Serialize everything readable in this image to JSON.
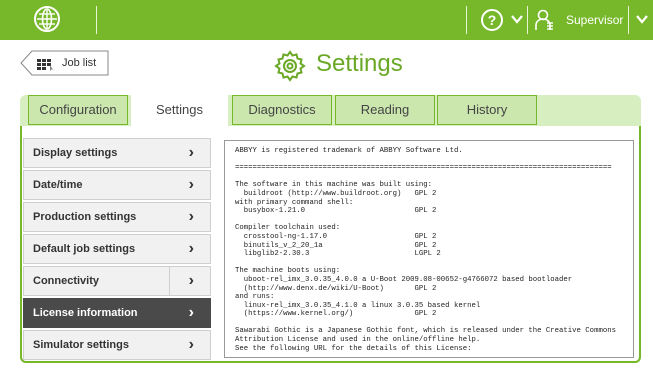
{
  "topbar": {
    "language_icon": "globe-icon",
    "help_icon": "help-icon",
    "user_icon": "user-icon",
    "user_label": "Supervisor",
    "dropdown_icon": "chevron-down-icon"
  },
  "header": {
    "back_button_label": "Job list",
    "back_icon": "job-list-icon",
    "title_icon": "gear-icon",
    "title": "Settings"
  },
  "tabs": [
    {
      "label": "Configuration",
      "active": false
    },
    {
      "label": "Settings",
      "active": true
    },
    {
      "label": "Diagnostics",
      "active": false
    },
    {
      "label": "Reading",
      "active": false
    },
    {
      "label": "History",
      "active": false
    }
  ],
  "menu": [
    {
      "label": "Display settings",
      "active": false
    },
    {
      "label": "Date/time",
      "active": false
    },
    {
      "label": "Production settings",
      "active": false
    },
    {
      "label": "Default job settings",
      "active": false
    },
    {
      "label": "Connectivity",
      "active": false
    },
    {
      "label": "License information",
      "active": true
    },
    {
      "label": "Simulator settings",
      "active": false
    }
  ],
  "license_text": "ABBYY is registered trademark of ABBYY Software Ltd.\n\n======================================================================================\n\nThe software in this machine was built using:\n  buildroot (http://www.buildroot.org)   GPL 2\nwith primary command shell:\n  busybox-1.21.0                         GPL 2\n\nCompiler toolchain used:\n  crosstool-ng-1.17.0                    GPL 2\n  binutils_v_2_20_1a                     GPL 2\n  libglib2-2.30.3                        LGPL 2\n\nThe machine boots using:\n  uboot-rel_imx_3.0.35_4.0.0 a U-Boot 2009.08-00652-g4766072 based bootloader\n  (http://www.denx.de/wiki/U-Boot)       GPL 2\nand runs:\n  linux-rel_imx_3.0.35_4.1.0 a linux 3.0.35 based kernel\n  (https://www.kernel.org/)              GPL 2\n\nSawarabi Gothic is a Japanese Gothic font, which is released under the Creative Commons\nAttribution License and used in the online/offline help.\nSee the following URL for the details of this License:",
  "colors": {
    "brand_green": "#76b82a",
    "tab_inactive": "#cbe7ae",
    "menu_active": "#4a4a4a"
  }
}
